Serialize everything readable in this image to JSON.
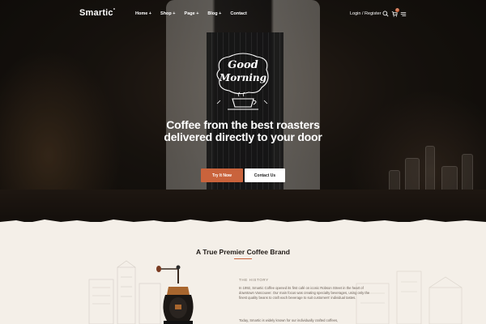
{
  "brand": {
    "name": "Smartic",
    "mark": "°"
  },
  "nav": {
    "items": [
      {
        "label": "Home +"
      },
      {
        "label": "Shop +"
      },
      {
        "label": "Page +"
      },
      {
        "label": "Blog +"
      },
      {
        "label": "Contact"
      }
    ],
    "login_label": "Login / Register",
    "icons": [
      "search-icon",
      "cart-icon",
      "menu-icon"
    ],
    "cart_count": "0"
  },
  "hero": {
    "badge_line1": "Good",
    "badge_line2": "Morning",
    "headline": "Coffee from the best roasters delivered directly to your door",
    "primary_button": "Try It Now",
    "secondary_button": "Contact Us"
  },
  "about": {
    "title": "A True Premier Coffee Brand",
    "kicker": "THE HISTORY",
    "paragraph1": "In 1992, Smartic Coffee opened its first café on iconic Robson Street in the heart of downtown Vancouver. Our main focus was creating specialty beverages, using only the finest quality beans to craft each beverage to suit customers' individual tastes.",
    "paragraph2": "Today, Smartic is widely known for our individually crafted coffees,"
  },
  "colors": {
    "accent": "#c9633c",
    "dark": "#1f1a16",
    "cream": "#f4efe8"
  }
}
